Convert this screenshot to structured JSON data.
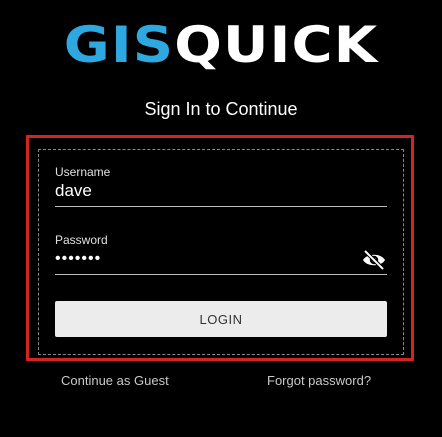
{
  "app": {
    "logo_part1": "GIS",
    "logo_part2": "QUICK",
    "logo_colors": {
      "part1": "#2fa8e0",
      "part2": "#ffffff"
    }
  },
  "login": {
    "title": "Sign In to Continue",
    "username_label": "Username",
    "username_value": "dave",
    "password_label": "Password",
    "password_value": "•••••••",
    "password_toggle_icon": "eye-off-icon",
    "login_button_label": "LOGIN"
  },
  "links": {
    "guest": "Continue as Guest",
    "forgot": "Forgot password?"
  },
  "colors": {
    "background": "#000000",
    "highlight_frame": "#d42323",
    "button_bg": "#ececec"
  }
}
